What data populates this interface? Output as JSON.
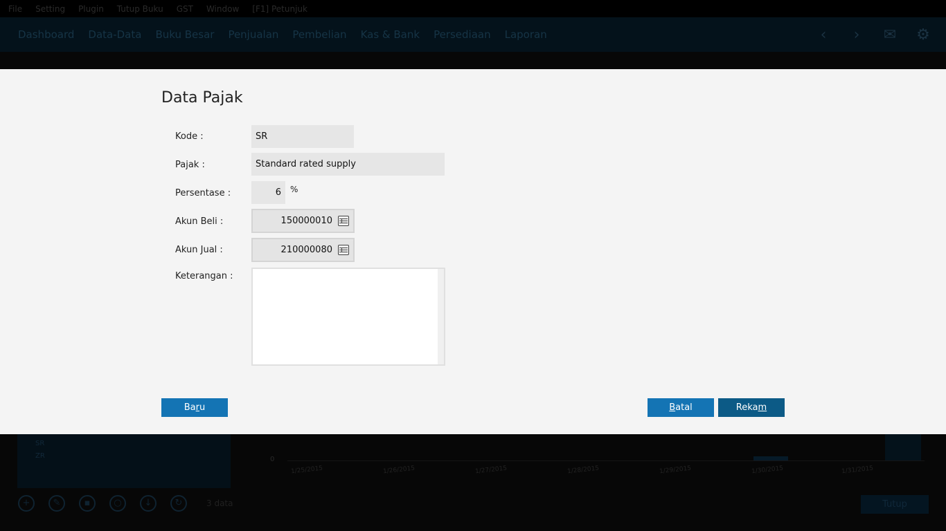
{
  "background": {
    "menu": [
      "File",
      "Setting",
      "Plugin",
      "Tutup Buku",
      "GST",
      "Window",
      "[F1] Petunjuk"
    ],
    "nav": [
      "Dashboard",
      "Data-Data",
      "Buku Besar",
      "Penjualan",
      "Pembelian",
      "Kas & Bank",
      "Persediaan",
      "Laporan"
    ],
    "nav_icons": [
      "chevron-left-icon",
      "chevron-right-icon",
      "mail-icon",
      "gear-icon"
    ],
    "chart_zero": "0",
    "chart_ticks": [
      "1/25/2015",
      "1/26/2015",
      "1/27/2015",
      "1/28/2015",
      "1/29/2015",
      "1/30/2015",
      "1/31/2015"
    ],
    "panel_items": [
      "SR",
      "ZR"
    ],
    "record_count": "3 data",
    "close_label": "Tutup"
  },
  "dialog": {
    "title": "Data Pajak",
    "labels": {
      "kode": "Kode :",
      "pajak": "Pajak :",
      "persentase": "Persentase :",
      "akun_beli": "Akun Beli :",
      "akun_jual": "Akun Jual :",
      "keterangan": "Keterangan :"
    },
    "values": {
      "kode": "SR",
      "pajak": "Standard rated supply",
      "persentase": "6",
      "persentase_unit": "%",
      "akun_beli": "150000010",
      "akun_jual": "210000080",
      "keterangan": ""
    },
    "buttons": {
      "baru_pre": "Ba",
      "baru_key": "r",
      "baru_post": "u",
      "batal_key": "B",
      "batal_post": "atal",
      "rekam_pre": "Reka",
      "rekam_key": "m"
    }
  }
}
